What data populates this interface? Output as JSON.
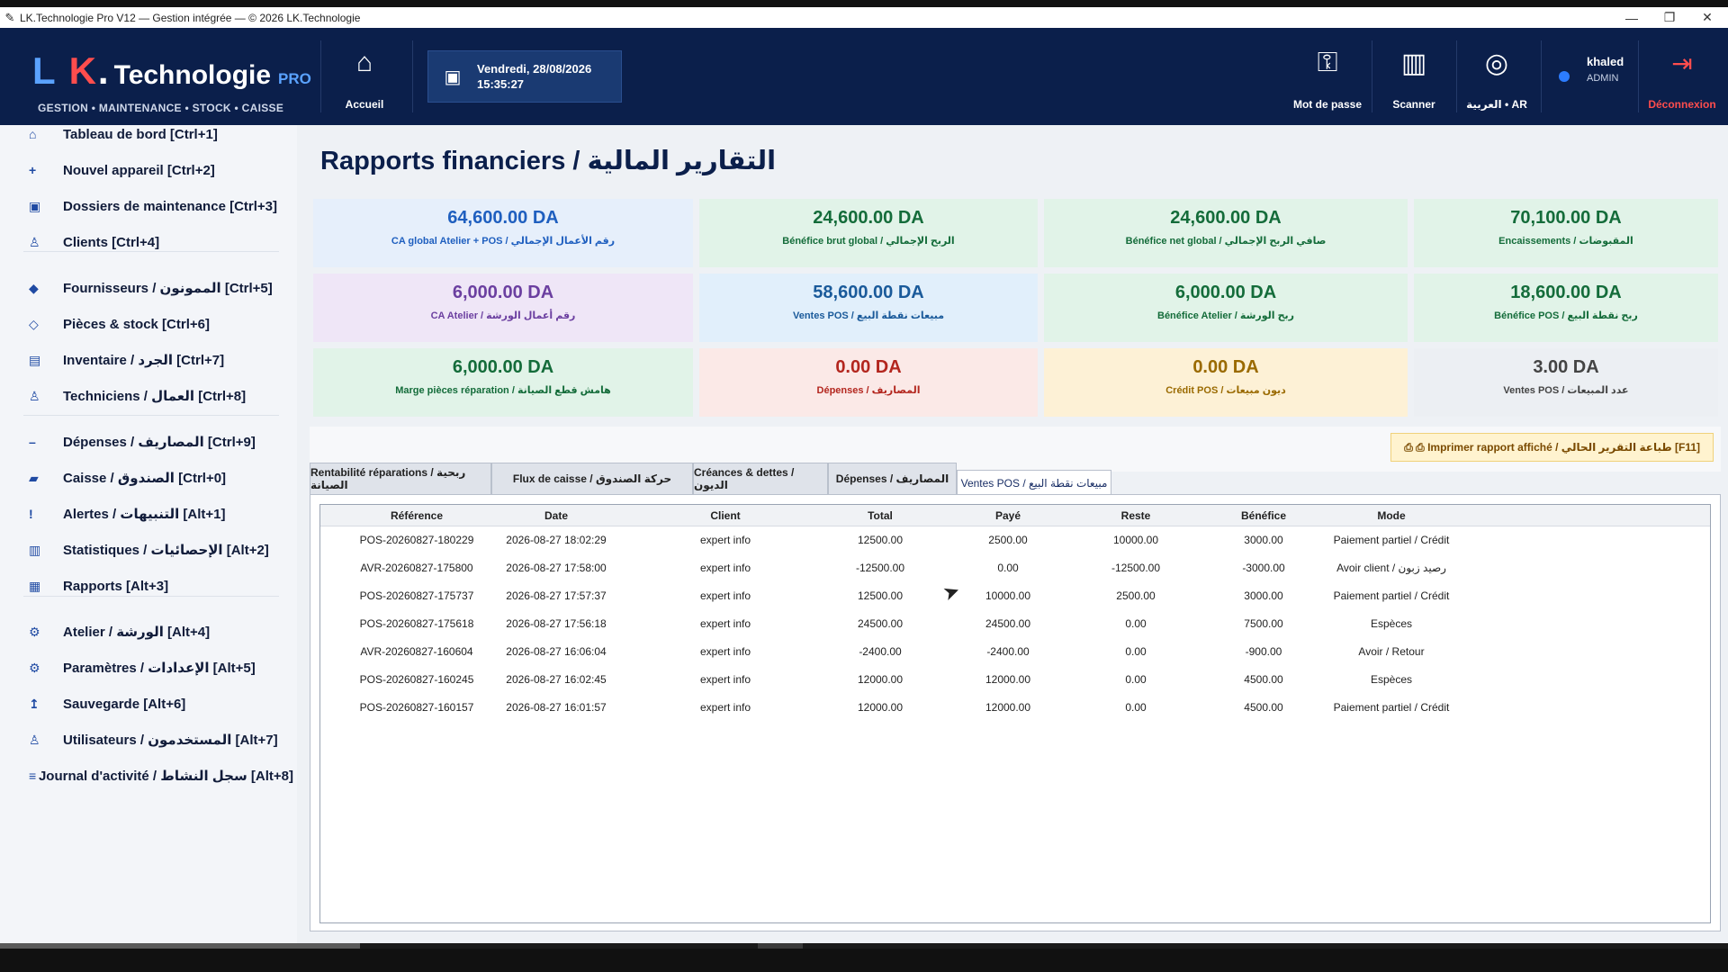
{
  "window": {
    "title": "LK.Technologie Pro V12 — Gestion intégrée — © 2026 LK.Technologie",
    "minimize": "—",
    "maximize": "❐",
    "close": "✕"
  },
  "header": {
    "logo_l": "L",
    "logo_k": "K",
    "logo_dot": ".",
    "logo_tech": "Technologie",
    "logo_pro": "PRO",
    "tagline": "GESTION • MAINTENANCE • STOCK • CAISSE",
    "home_label": "Accueil",
    "date_line": "Vendredi, 28/08/2026",
    "time_line": "15:35:27",
    "password_label": "Mot de passe",
    "scanner_label": "Scanner",
    "language_label": "العربية • AR",
    "user_name": "khaled",
    "user_role": "ADMIN",
    "logout_label": "Déconnexion"
  },
  "sidebar": {
    "items": [
      {
        "label": "Tableau de bord  [Ctrl+1]",
        "icon": "home-icon",
        "glyph": "⌂"
      },
      {
        "label": "Nouvel appareil  [Ctrl+2]",
        "icon": "plus-icon",
        "glyph": "+"
      },
      {
        "label": "Dossiers de maintenance  [Ctrl+3]",
        "icon": "folder-icon",
        "glyph": "▣"
      },
      {
        "label": "Clients  [Ctrl+4]",
        "icon": "person-icon",
        "glyph": "♙"
      },
      {
        "label": "Fournisseurs / الممونون  [Ctrl+5]",
        "icon": "diamond-icon",
        "glyph": "◆"
      },
      {
        "label": "Pièces & stock  [Ctrl+6]",
        "icon": "outline-diamond-icon",
        "glyph": "◇"
      },
      {
        "label": "Inventaire / الجرد  [Ctrl+7]",
        "icon": "list-icon",
        "glyph": "▤"
      },
      {
        "label": "Techniciens / العمال  [Ctrl+8]",
        "icon": "technician-icon",
        "glyph": "♙"
      },
      {
        "label": "Dépenses / المصاريف  [Ctrl+9]",
        "icon": "minus-icon",
        "glyph": "–"
      },
      {
        "label": "Caisse / الصندوق  [Ctrl+0]",
        "icon": "cashbox-icon",
        "glyph": "▰"
      },
      {
        "label": "Alertes / التنبيهات  [Alt+1]",
        "icon": "alert-icon",
        "glyph": "!"
      },
      {
        "label": "Statistiques / الإحصائيات  [Alt+2]",
        "icon": "stats-icon",
        "glyph": "▥"
      },
      {
        "label": "Rapports  [Alt+3]",
        "icon": "reports-icon",
        "glyph": "▦"
      },
      {
        "label": "Atelier / الورشة  [Alt+4]",
        "icon": "workshop-icon",
        "glyph": "⚙"
      },
      {
        "label": "Paramètres / الإعدادات  [Alt+5]",
        "icon": "settings-icon",
        "glyph": "⚙"
      },
      {
        "label": "Sauvegarde  [Alt+6]",
        "icon": "backup-icon",
        "glyph": "↥"
      },
      {
        "label": "Utilisateurs / المستخدمون  [Alt+7]",
        "icon": "users-icon",
        "glyph": "♙"
      },
      {
        "label": "Journal d'activité / سجل النشاط  [Alt+8]",
        "icon": "journal-icon",
        "glyph": "≡"
      }
    ]
  },
  "main": {
    "title": "Rapports financiers / التقارير المالية",
    "cards": [
      {
        "value": "64,600.00 DA",
        "label": "CA global Atelier + POS / رقم الأعمال الإجمالي",
        "bg": "#e6effb",
        "color": "#1f5fbf"
      },
      {
        "value": "24,600.00 DA",
        "label": "Bénéfice brut global / الربح الإجمالي",
        "bg": "#e1f3e8",
        "color": "#146c3a"
      },
      {
        "value": "24,600.00 DA",
        "label": "Bénéfice net global / صافي الربح الإجمالي",
        "bg": "#e1f3e8",
        "color": "#146c3a"
      },
      {
        "value": "70,100.00 DA",
        "label": "Encaissements / المقبوضات",
        "bg": "#e1f3e8",
        "color": "#146c3a"
      },
      {
        "value": "6,000.00 DA",
        "label": "CA Atelier / رقم أعمال الورشة",
        "bg": "#efe6f7",
        "color": "#6b3fa0"
      },
      {
        "value": "58,600.00 DA",
        "label": "Ventes POS / مبيعات نقطة البيع",
        "bg": "#e1effb",
        "color": "#1a5a9a"
      },
      {
        "value": "6,000.00 DA",
        "label": "Bénéfice Atelier / ربح الورشة",
        "bg": "#e1f3e8",
        "color": "#146c3a"
      },
      {
        "value": "18,600.00 DA",
        "label": "Bénéfice POS / ربح نقطة البيع",
        "bg": "#e1f3e8",
        "color": "#146c3a"
      },
      {
        "value": "6,000.00 DA",
        "label": "Marge pièces réparation / هامش قطع الصيانة",
        "bg": "#e1f3e8",
        "color": "#146c3a"
      },
      {
        "value": "0.00 DA",
        "label": "Dépenses / المصاريف",
        "bg": "#fbe9e7",
        "color": "#b3261e"
      },
      {
        "value": "0.00 DA",
        "label": "Crédit POS / ديون مبيعات",
        "bg": "#fdf1d6",
        "color": "#9a6a00"
      },
      {
        "value": "3.00 DA",
        "label": "Ventes POS / عدد المبيعات",
        "bg": "#eceff3",
        "color": "#444"
      }
    ],
    "print_button": "⎙ ⎙  Imprimer rapport affiché / طباعة التقرير الحالي   [F11]",
    "tabs": [
      "Rentabilité réparations / ربحية الصيانة",
      "Flux de caisse / حركة الصندوق",
      "Créances & dettes / الديون",
      "Dépenses / المصاريف",
      "Ventes POS / مبيعات نقطة البيع"
    ],
    "table": {
      "columns": [
        "Référence",
        "Date",
        "Client",
        "Total",
        "Payé",
        "Reste",
        "Bénéfice",
        "Mode"
      ],
      "rows": [
        [
          "POS-20260827-180229",
          "2026-08-27 18:02:29",
          "expert info",
          "12500.00",
          "2500.00",
          "10000.00",
          "3000.00",
          "Paiement partiel / Crédit"
        ],
        [
          "AVR-20260827-175800",
          "2026-08-27 17:58:00",
          "expert info",
          "-12500.00",
          "0.00",
          "-12500.00",
          "-3000.00",
          "Avoir client / رصيد زبون"
        ],
        [
          "POS-20260827-175737",
          "2026-08-27 17:57:37",
          "expert info",
          "12500.00",
          "10000.00",
          "2500.00",
          "3000.00",
          "Paiement partiel / Crédit"
        ],
        [
          "POS-20260827-175618",
          "2026-08-27 17:56:18",
          "expert info",
          "24500.00",
          "24500.00",
          "0.00",
          "7500.00",
          "Espèces"
        ],
        [
          "AVR-20260827-160604",
          "2026-08-27 16:06:04",
          "expert info",
          "-2400.00",
          "-2400.00",
          "0.00",
          "-900.00",
          "Avoir / Retour"
        ],
        [
          "POS-20260827-160245",
          "2026-08-27 16:02:45",
          "expert info",
          "12000.00",
          "12000.00",
          "0.00",
          "4500.00",
          "Espèces"
        ],
        [
          "POS-20260827-160157",
          "2026-08-27 16:01:57",
          "expert info",
          "12000.00",
          "12000.00",
          "0.00",
          "4500.00",
          "Paiement partiel / Crédit"
        ]
      ]
    }
  }
}
